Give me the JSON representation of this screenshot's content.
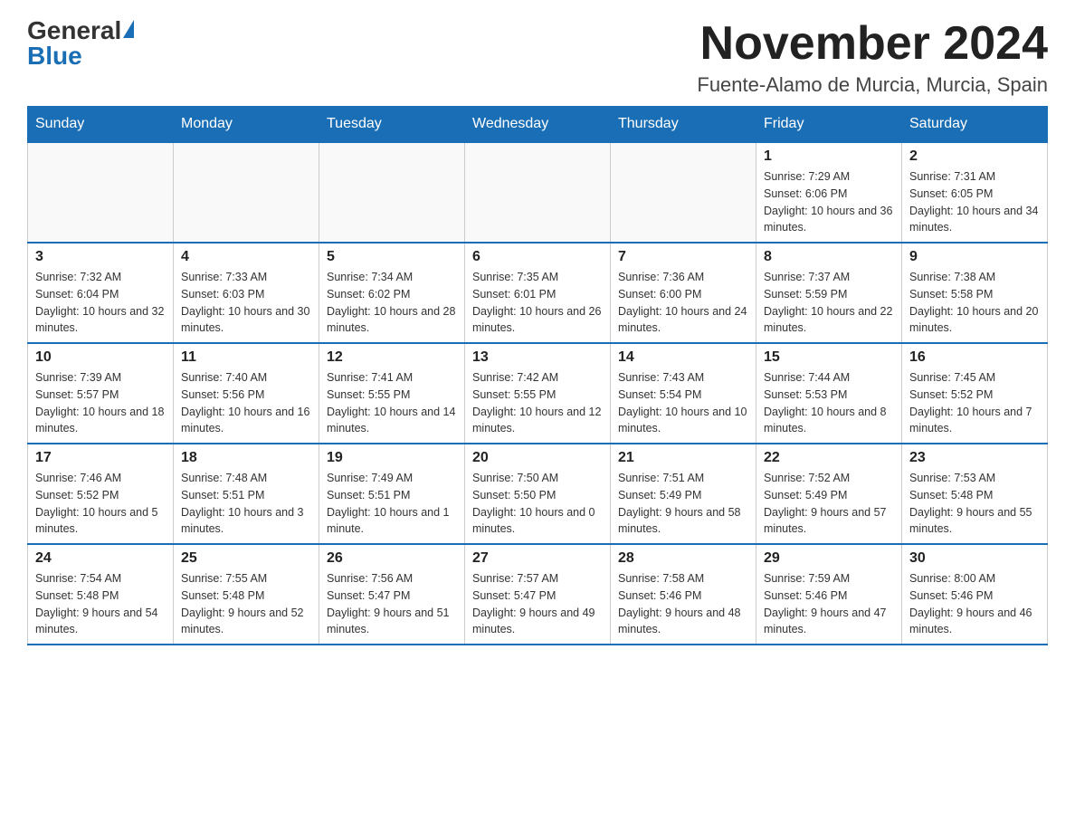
{
  "header": {
    "logo": {
      "general": "General",
      "blue": "Blue",
      "triangle_alt": "triangle logo"
    },
    "title": "November 2024",
    "location": "Fuente-Alamo de Murcia, Murcia, Spain"
  },
  "days_of_week": [
    "Sunday",
    "Monday",
    "Tuesday",
    "Wednesday",
    "Thursday",
    "Friday",
    "Saturday"
  ],
  "weeks": [
    {
      "days": [
        {
          "num": "",
          "info": "",
          "empty": true
        },
        {
          "num": "",
          "info": "",
          "empty": true
        },
        {
          "num": "",
          "info": "",
          "empty": true
        },
        {
          "num": "",
          "info": "",
          "empty": true
        },
        {
          "num": "",
          "info": "",
          "empty": true
        },
        {
          "num": "1",
          "info": "Sunrise: 7:29 AM\nSunset: 6:06 PM\nDaylight: 10 hours and 36 minutes.",
          "empty": false
        },
        {
          "num": "2",
          "info": "Sunrise: 7:31 AM\nSunset: 6:05 PM\nDaylight: 10 hours and 34 minutes.",
          "empty": false
        }
      ]
    },
    {
      "days": [
        {
          "num": "3",
          "info": "Sunrise: 7:32 AM\nSunset: 6:04 PM\nDaylight: 10 hours and 32 minutes.",
          "empty": false
        },
        {
          "num": "4",
          "info": "Sunrise: 7:33 AM\nSunset: 6:03 PM\nDaylight: 10 hours and 30 minutes.",
          "empty": false
        },
        {
          "num": "5",
          "info": "Sunrise: 7:34 AM\nSunset: 6:02 PM\nDaylight: 10 hours and 28 minutes.",
          "empty": false
        },
        {
          "num": "6",
          "info": "Sunrise: 7:35 AM\nSunset: 6:01 PM\nDaylight: 10 hours and 26 minutes.",
          "empty": false
        },
        {
          "num": "7",
          "info": "Sunrise: 7:36 AM\nSunset: 6:00 PM\nDaylight: 10 hours and 24 minutes.",
          "empty": false
        },
        {
          "num": "8",
          "info": "Sunrise: 7:37 AM\nSunset: 5:59 PM\nDaylight: 10 hours and 22 minutes.",
          "empty": false
        },
        {
          "num": "9",
          "info": "Sunrise: 7:38 AM\nSunset: 5:58 PM\nDaylight: 10 hours and 20 minutes.",
          "empty": false
        }
      ]
    },
    {
      "days": [
        {
          "num": "10",
          "info": "Sunrise: 7:39 AM\nSunset: 5:57 PM\nDaylight: 10 hours and 18 minutes.",
          "empty": false
        },
        {
          "num": "11",
          "info": "Sunrise: 7:40 AM\nSunset: 5:56 PM\nDaylight: 10 hours and 16 minutes.",
          "empty": false
        },
        {
          "num": "12",
          "info": "Sunrise: 7:41 AM\nSunset: 5:55 PM\nDaylight: 10 hours and 14 minutes.",
          "empty": false
        },
        {
          "num": "13",
          "info": "Sunrise: 7:42 AM\nSunset: 5:55 PM\nDaylight: 10 hours and 12 minutes.",
          "empty": false
        },
        {
          "num": "14",
          "info": "Sunrise: 7:43 AM\nSunset: 5:54 PM\nDaylight: 10 hours and 10 minutes.",
          "empty": false
        },
        {
          "num": "15",
          "info": "Sunrise: 7:44 AM\nSunset: 5:53 PM\nDaylight: 10 hours and 8 minutes.",
          "empty": false
        },
        {
          "num": "16",
          "info": "Sunrise: 7:45 AM\nSunset: 5:52 PM\nDaylight: 10 hours and 7 minutes.",
          "empty": false
        }
      ]
    },
    {
      "days": [
        {
          "num": "17",
          "info": "Sunrise: 7:46 AM\nSunset: 5:52 PM\nDaylight: 10 hours and 5 minutes.",
          "empty": false
        },
        {
          "num": "18",
          "info": "Sunrise: 7:48 AM\nSunset: 5:51 PM\nDaylight: 10 hours and 3 minutes.",
          "empty": false
        },
        {
          "num": "19",
          "info": "Sunrise: 7:49 AM\nSunset: 5:51 PM\nDaylight: 10 hours and 1 minute.",
          "empty": false
        },
        {
          "num": "20",
          "info": "Sunrise: 7:50 AM\nSunset: 5:50 PM\nDaylight: 10 hours and 0 minutes.",
          "empty": false
        },
        {
          "num": "21",
          "info": "Sunrise: 7:51 AM\nSunset: 5:49 PM\nDaylight: 9 hours and 58 minutes.",
          "empty": false
        },
        {
          "num": "22",
          "info": "Sunrise: 7:52 AM\nSunset: 5:49 PM\nDaylight: 9 hours and 57 minutes.",
          "empty": false
        },
        {
          "num": "23",
          "info": "Sunrise: 7:53 AM\nSunset: 5:48 PM\nDaylight: 9 hours and 55 minutes.",
          "empty": false
        }
      ]
    },
    {
      "days": [
        {
          "num": "24",
          "info": "Sunrise: 7:54 AM\nSunset: 5:48 PM\nDaylight: 9 hours and 54 minutes.",
          "empty": false
        },
        {
          "num": "25",
          "info": "Sunrise: 7:55 AM\nSunset: 5:48 PM\nDaylight: 9 hours and 52 minutes.",
          "empty": false
        },
        {
          "num": "26",
          "info": "Sunrise: 7:56 AM\nSunset: 5:47 PM\nDaylight: 9 hours and 51 minutes.",
          "empty": false
        },
        {
          "num": "27",
          "info": "Sunrise: 7:57 AM\nSunset: 5:47 PM\nDaylight: 9 hours and 49 minutes.",
          "empty": false
        },
        {
          "num": "28",
          "info": "Sunrise: 7:58 AM\nSunset: 5:46 PM\nDaylight: 9 hours and 48 minutes.",
          "empty": false
        },
        {
          "num": "29",
          "info": "Sunrise: 7:59 AM\nSunset: 5:46 PM\nDaylight: 9 hours and 47 minutes.",
          "empty": false
        },
        {
          "num": "30",
          "info": "Sunrise: 8:00 AM\nSunset: 5:46 PM\nDaylight: 9 hours and 46 minutes.",
          "empty": false
        }
      ]
    }
  ]
}
